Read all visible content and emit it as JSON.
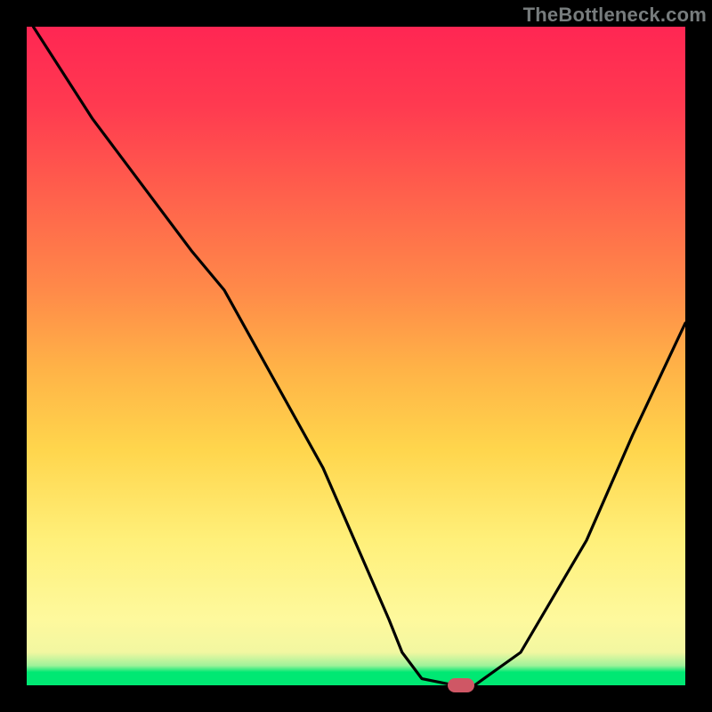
{
  "attribution": "TheBottleneck.com",
  "chart_data": {
    "type": "line",
    "title": "",
    "xlabel": "",
    "ylabel": "",
    "xlim": [
      0,
      100
    ],
    "ylim": [
      0,
      100
    ],
    "grid": false,
    "series": [
      {
        "name": "curve",
        "x": [
          1,
          10,
          25,
          30,
          45,
          55,
          57,
          60,
          65,
          68,
          75,
          85,
          92,
          100
        ],
        "y": [
          100,
          86,
          66,
          60,
          33,
          10,
          5,
          1,
          0,
          0,
          5,
          22,
          38,
          55
        ]
      }
    ],
    "marker": {
      "x": 66,
      "y": 0
    },
    "colors": {
      "curve": "#000000",
      "marker": "#cf5765",
      "gradient_top": "#ff2653",
      "gradient_bottom": "#00e873"
    }
  }
}
